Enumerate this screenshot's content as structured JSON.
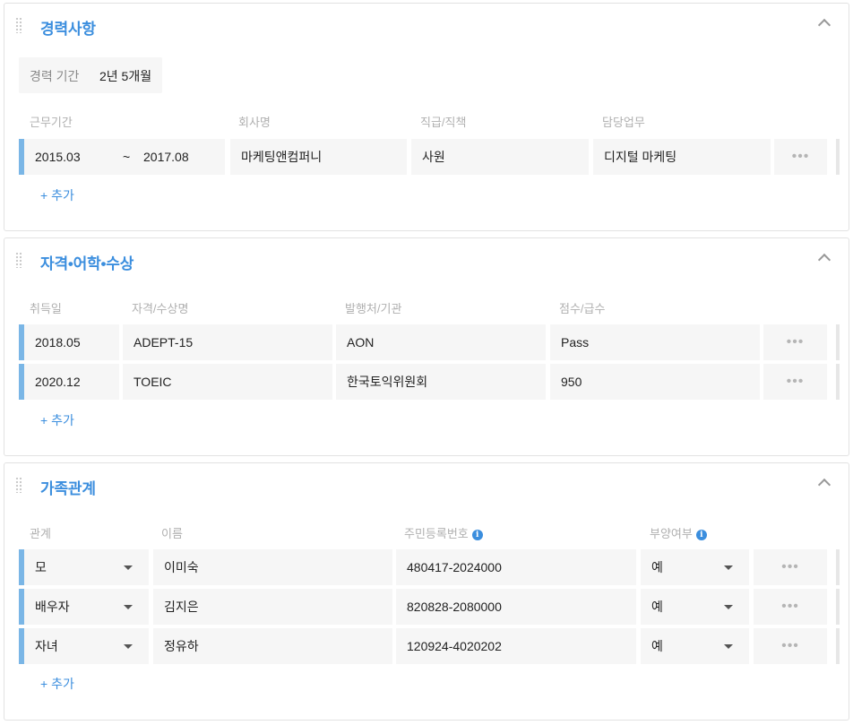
{
  "career": {
    "title": "경력사항",
    "period_label": "경력 기간",
    "period_value": "2년 5개월",
    "headers": [
      "근무기간",
      "회사명",
      "직급/직책",
      "담당업무"
    ],
    "rows": [
      {
        "start": "2015.03",
        "sep": "~",
        "end": "2017.08",
        "company": "마케팅앤컴퍼니",
        "position": "사원",
        "duty": "디지털 마케팅"
      }
    ],
    "add_label": "+ 추가",
    "more_label": "•••"
  },
  "cert": {
    "title": "자격•어학•수상",
    "headers": [
      "취득일",
      "자격/수상명",
      "발행처/기관",
      "점수/급수"
    ],
    "rows": [
      {
        "date": "2018.05",
        "name": "ADEPT-15",
        "issuer": "AON",
        "score": "Pass"
      },
      {
        "date": "2020.12",
        "name": "TOEIC",
        "issuer": "한국토익위원회",
        "score": "950"
      }
    ],
    "add_label": "+ 추가",
    "more_label": "•••"
  },
  "family": {
    "title": "가족관계",
    "headers": [
      "관계",
      "이름",
      "주민등록번호",
      "부양여부"
    ],
    "info_icon": "i",
    "rows": [
      {
        "relation": "모",
        "name": "이미숙",
        "id_number": "480417-2024000",
        "dependent": "예"
      },
      {
        "relation": "배우자",
        "name": "김지은",
        "id_number": "820828-2080000",
        "dependent": "예"
      },
      {
        "relation": "자녀",
        "name": "정유하",
        "id_number": "120924-4020202",
        "dependent": "예"
      }
    ],
    "add_label": "+ 추가",
    "more_label": "•••"
  },
  "colors": {
    "accent": "#3b8ede",
    "row_marker": "#7ab6e6",
    "cell_bg": "#f6f6f6"
  },
  "icons": [
    "drag-handle-icon",
    "chevron-up-icon",
    "more-icon",
    "dropdown-caret-icon",
    "info-icon"
  ]
}
